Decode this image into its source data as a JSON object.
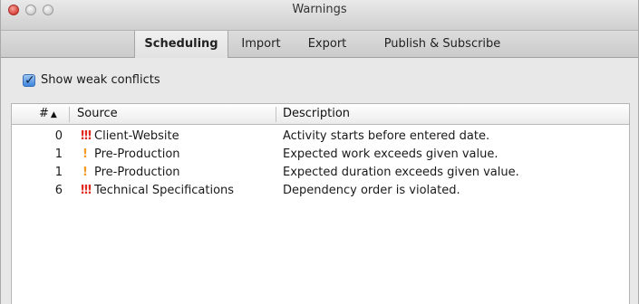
{
  "window": {
    "title": "Warnings"
  },
  "tabs": [
    {
      "label": "Scheduling",
      "active": true
    },
    {
      "label": "Import",
      "active": false
    },
    {
      "label": "Export",
      "active": false
    },
    {
      "label": "Publish & Subscribe",
      "active": false
    }
  ],
  "options": {
    "show_weak_conflicts_label": "Show weak conflicts",
    "show_weak_conflicts_checked": true
  },
  "table": {
    "columns": {
      "number": "#",
      "source": "Source",
      "description": "Description"
    },
    "sort_indicator": "▲",
    "rows": [
      {
        "number": "0",
        "severity": "!!!",
        "source": "Client-Website",
        "description": "Activity starts before entered date."
      },
      {
        "number": "1",
        "severity": "!",
        "source": "Pre-Production",
        "description": "Expected work exceeds given value."
      },
      {
        "number": "1",
        "severity": "!",
        "source": "Pre-Production",
        "description": "Expected duration exceeds given value."
      },
      {
        "number": "6",
        "severity": "!!!",
        "source": "Technical Specifications",
        "description": "Dependency order is violated."
      }
    ]
  },
  "colors": {
    "severity_high": "#e02a1f",
    "severity_low": "#f29b25",
    "checkbox": "#3d85de"
  }
}
